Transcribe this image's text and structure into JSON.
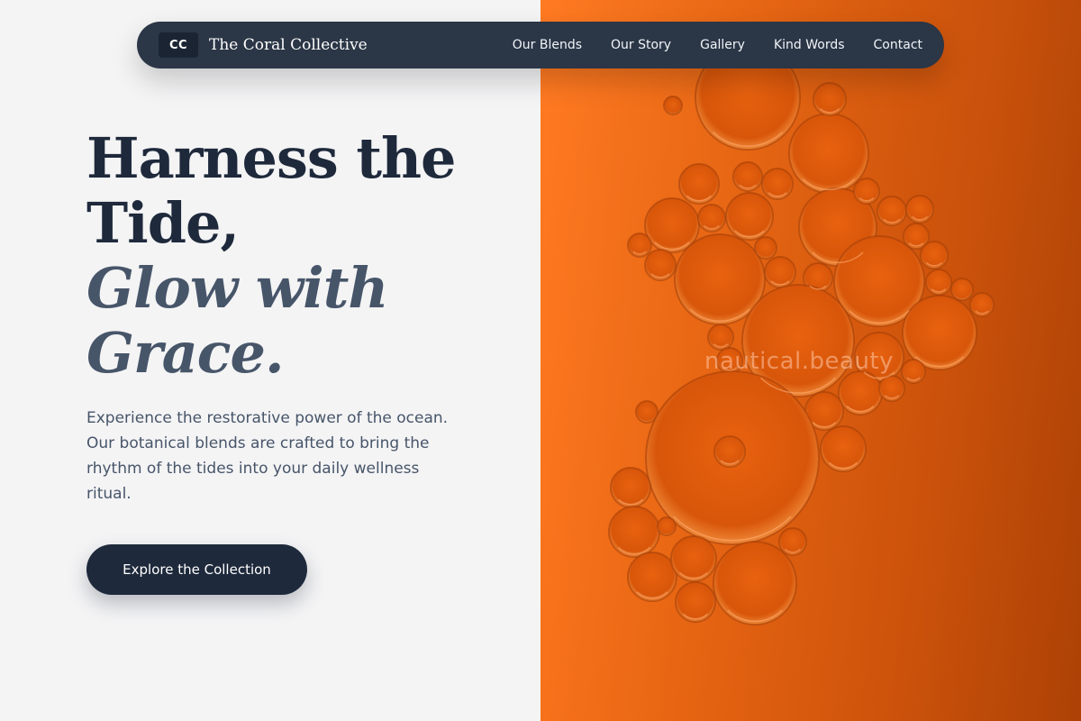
{
  "nav": {
    "logo_badge": "CC",
    "brand": "The Coral Collective",
    "links": [
      "Our Blends",
      "Our Story",
      "Gallery",
      "Kind Words",
      "Contact"
    ]
  },
  "hero": {
    "title_line1": "Harness the",
    "title_line2": "Tide,",
    "title_line3": "Glow with",
    "title_line4": "Grace.",
    "description": "Experience the restorative power of the ocean. Our botanical blends are crafted to bring the rhythm of the tides into your daily wellness ritual.",
    "cta_label": "Explore the Collection"
  },
  "image": {
    "subject": "orange oil bubbles",
    "watermark": "nautical.beauty"
  },
  "colors": {
    "navy": "#1e293b",
    "slate": "#475569",
    "background": "#f4f4f5",
    "accent_orange": "#f06a14"
  }
}
